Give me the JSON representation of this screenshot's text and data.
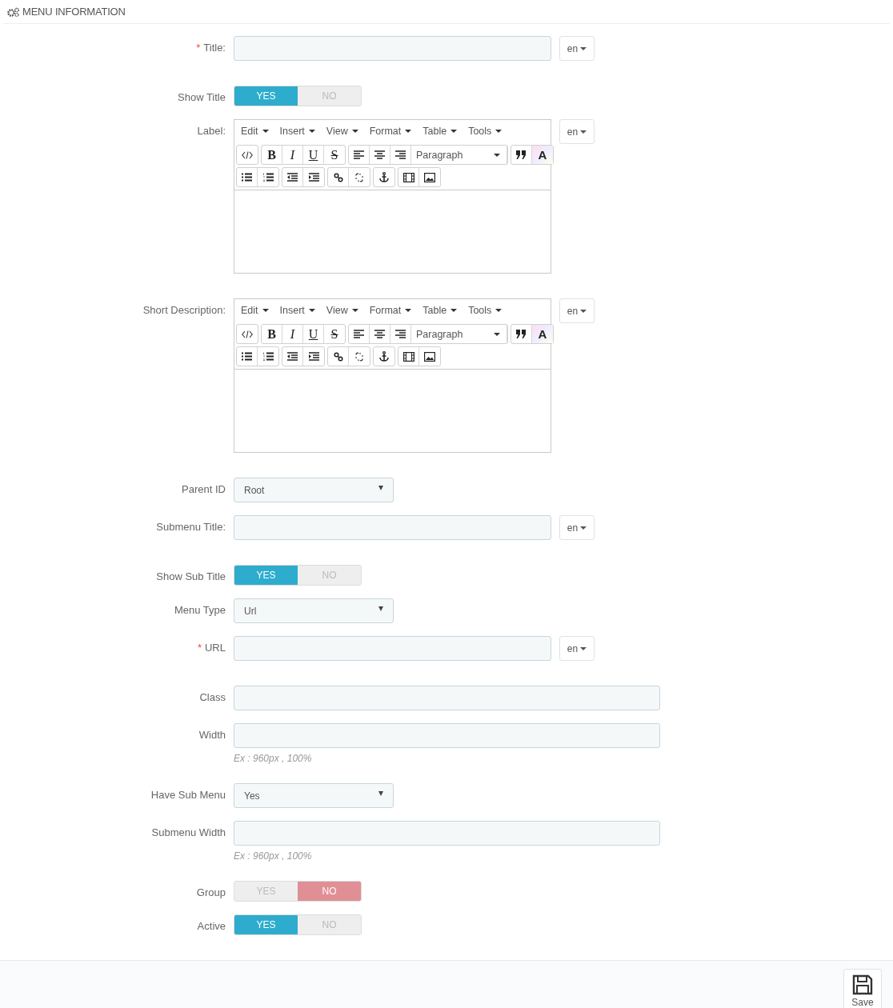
{
  "header": {
    "title": "MENU INFORMATION"
  },
  "fields": [
    {
      "kind": "text",
      "label": "Title:",
      "required_mark": "*",
      "lang": "en"
    },
    {
      "kind": "switch",
      "label": "Show Title",
      "options": [
        {
          "label": "YES",
          "selected": true
        },
        {
          "label": "NO",
          "selected": false
        }
      ]
    },
    {
      "kind": "editor",
      "label": "Label:",
      "menus": [
        "Edit",
        "Insert",
        "View",
        "Format",
        "Table",
        "Tools"
      ],
      "format_letters": [
        "B",
        "I",
        "U",
        "S"
      ],
      "block_format": "Paragraph",
      "color_letter": "A",
      "lang": "en"
    },
    {
      "kind": "editor",
      "label": "Short Description:",
      "menus": [
        "Edit",
        "Insert",
        "View",
        "Format",
        "Table",
        "Tools"
      ],
      "format_letters": [
        "B",
        "I",
        "U",
        "S"
      ],
      "block_format": "Paragraph",
      "color_letter": "A",
      "lang": "en"
    },
    {
      "kind": "select",
      "label": "Parent ID",
      "value": "Root"
    },
    {
      "kind": "text",
      "label": "Submenu Title:",
      "lang": "en"
    },
    {
      "kind": "switch",
      "label": "Show Sub Title",
      "options": [
        {
          "label": "YES",
          "selected": true
        },
        {
          "label": "NO",
          "selected": false
        }
      ]
    },
    {
      "kind": "select",
      "label": "Menu Type",
      "value": "Url"
    },
    {
      "kind": "text",
      "label": "URL",
      "required_mark": "*",
      "lang": "en"
    },
    {
      "kind": "text",
      "label": "Class"
    },
    {
      "kind": "text",
      "label": "Width",
      "hint": "Ex : 960px , 100%"
    },
    {
      "kind": "select",
      "label": "Have Sub Menu",
      "value": "Yes"
    },
    {
      "kind": "text",
      "label": "Submenu Width",
      "hint": "Ex : 960px , 100%"
    },
    {
      "kind": "switch",
      "label": "Group",
      "options": [
        {
          "label": "YES",
          "selected": false
        },
        {
          "label": "NO",
          "selected": true
        }
      ]
    },
    {
      "kind": "switch",
      "label": "Active",
      "options": [
        {
          "label": "YES",
          "selected": true
        },
        {
          "label": "NO",
          "selected": false
        }
      ]
    }
  ],
  "footer": {
    "save": "Save"
  }
}
